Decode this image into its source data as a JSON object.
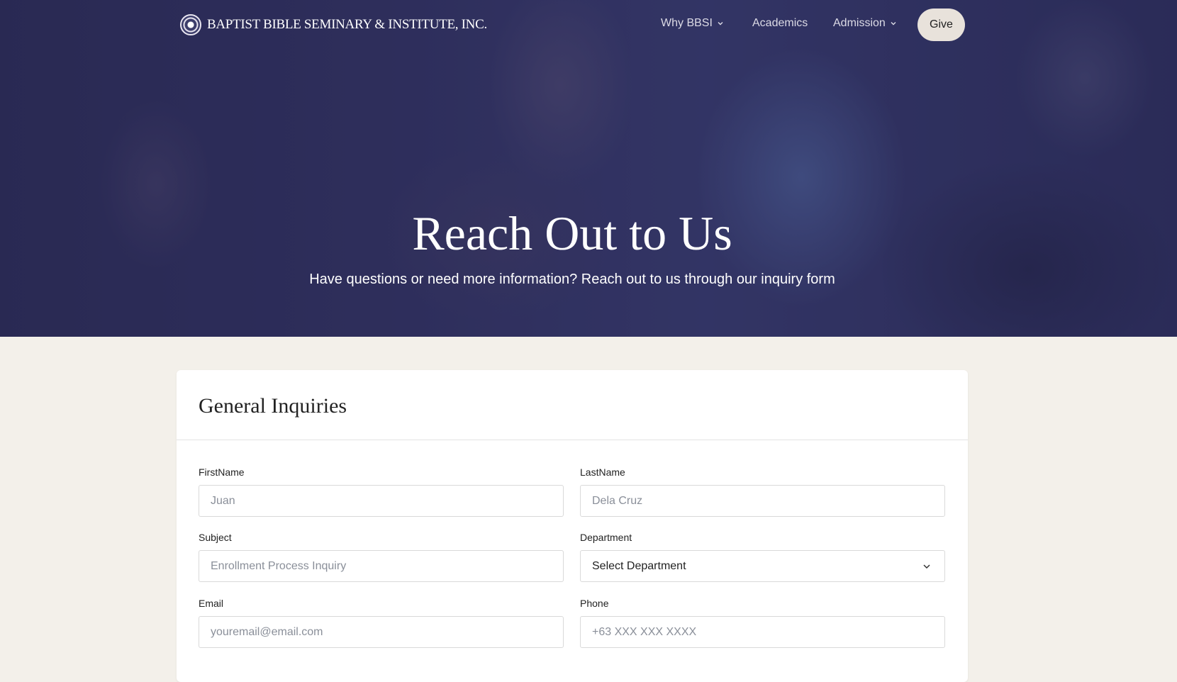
{
  "nav": {
    "logo_text": "BAPTIST BIBLE SEMINARY & INSTITUTE, INC.",
    "items": [
      {
        "label": "Why BBSI",
        "has_dropdown": true
      },
      {
        "label": "Academics",
        "has_dropdown": false
      },
      {
        "label": "Admission",
        "has_dropdown": true
      }
    ],
    "give_label": "Give"
  },
  "hero": {
    "title": "Reach Out to Us",
    "subtitle": "Have questions or need more information? Reach out to us through our inquiry form"
  },
  "form": {
    "title": "General Inquiries",
    "first_name": {
      "label": "FirstName",
      "placeholder": "Juan"
    },
    "last_name": {
      "label": "LastName",
      "placeholder": "Dela Cruz"
    },
    "subject": {
      "label": "Subject",
      "placeholder": "Enrollment Process Inquiry"
    },
    "department": {
      "label": "Department",
      "selected": "Select Department"
    },
    "email": {
      "label": "Email",
      "placeholder": "youremail@email.com"
    },
    "phone": {
      "label": "Phone",
      "placeholder": "+63 XXX XXX XXXX"
    }
  },
  "colors": {
    "hero_overlay": "#2d2d5a",
    "page_background": "#f3f0ea",
    "give_button": "#e8e2db"
  },
  "icons": [
    "seal-logo-icon",
    "chevron-down-icon"
  ]
}
